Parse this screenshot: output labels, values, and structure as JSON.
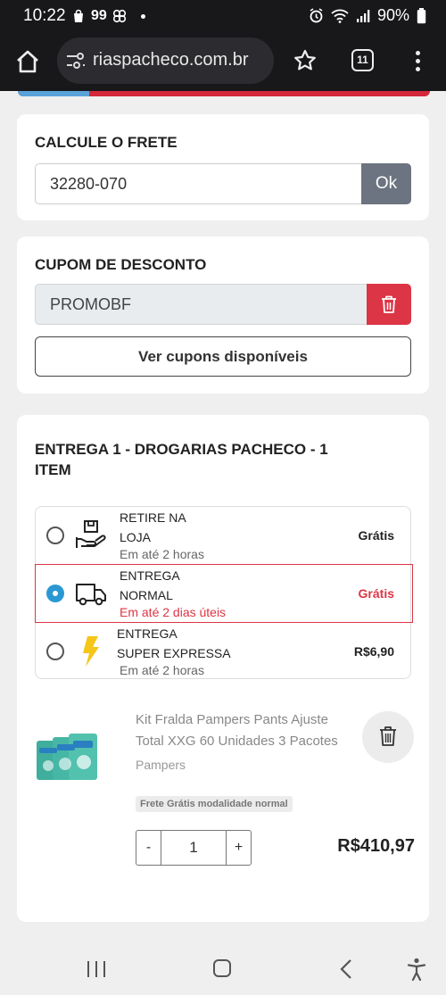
{
  "status_bar": {
    "time": "10:22",
    "battery": "90%",
    "notif_badge": "99"
  },
  "browser": {
    "url": "riaspacheco.com.br",
    "tab_count": "11"
  },
  "frete": {
    "title": "CALCULE O FRETE",
    "cep": "32280-070",
    "ok_label": "Ok"
  },
  "cupom": {
    "title": "CUPOM DE DESCONTO",
    "code": "PROMOBF",
    "ver_cupons_label": "Ver cupons disponíveis"
  },
  "entrega": {
    "title": "ENTREGA 1 - DROGARIAS PACHECO - 1 ITEM",
    "options": [
      {
        "name_line1": "RETIRE NA",
        "name_line2": "LOJA",
        "subtitle": "Em até 2 horas",
        "price": "Grátis",
        "selected": false,
        "icon": "store-pickup-icon"
      },
      {
        "name_line1": "ENTREGA",
        "name_line2": "NORMAL",
        "subtitle": "Em até 2 dias úteis",
        "price": "Grátis",
        "selected": true,
        "icon": "delivery-truck-icon"
      },
      {
        "name_line1": "ENTREGA",
        "name_line2": "SUPER EXPRESSA",
        "subtitle": "Em até 2 horas",
        "price": "R$6,90",
        "selected": false,
        "icon": "lightning-icon"
      }
    ],
    "accent_color": "#dc3545",
    "radio_color": "#2a98d2"
  },
  "product": {
    "name": "Kit Fralda Pampers Pants Ajuste Total XXG 60 Unidades 3 Pacotes",
    "brand": "Pampers",
    "badge": "Frete Grátis modalidade normal",
    "quantity": "1",
    "minus_label": "-",
    "plus_label": "+",
    "price": "R$410,97"
  }
}
